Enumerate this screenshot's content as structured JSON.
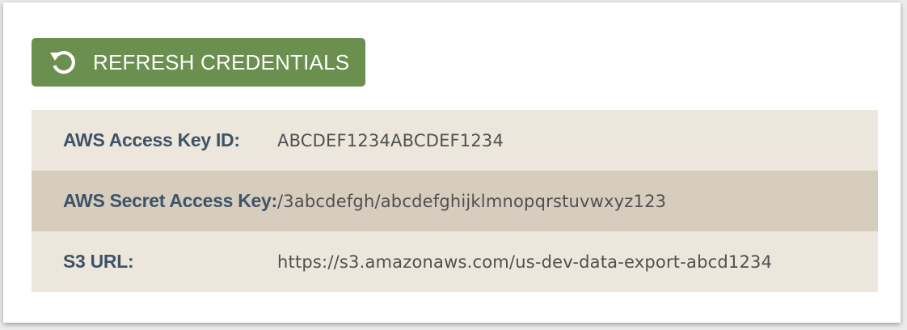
{
  "refresh_button": {
    "label": "REFRESH CREDENTIALS",
    "icon": "refresh-icon",
    "color": "#6a8f4e"
  },
  "credentials": [
    {
      "label": "AWS Access Key ID:",
      "value": "ABCDEF1234ABCDEF1234"
    },
    {
      "label": "AWS Secret Access Key:",
      "value": "/3abcdefgh/abcdefghijklmnopqrstuvwxyz123"
    },
    {
      "label": "S3 URL:",
      "value": "https://s3.amazonaws.com/us-dev-data-export-abcd1234"
    }
  ],
  "colors": {
    "row_light": "#ece6dd",
    "row_dark": "#d6cdbf",
    "label_text": "#3f5366"
  }
}
